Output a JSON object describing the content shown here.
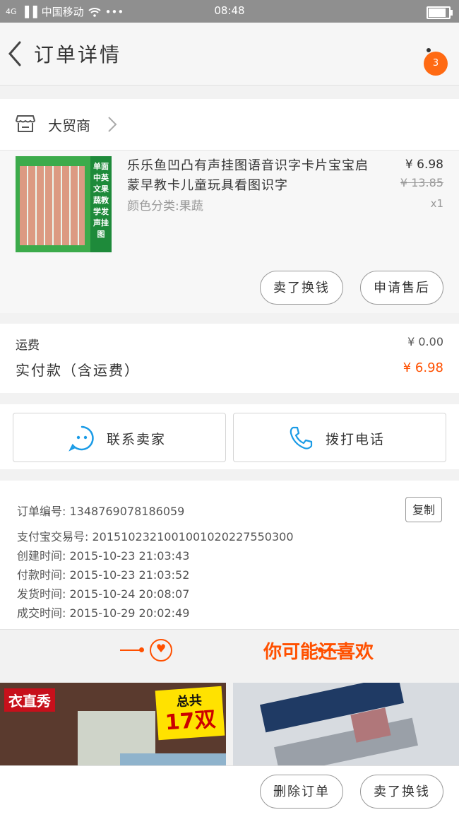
{
  "status_bar": {
    "signal": "4G",
    "carrier": "中国移动",
    "more": "•••",
    "time": "08:48",
    "battery_level": 0.85
  },
  "header": {
    "title": "订单详情",
    "notification_count": "3"
  },
  "shop": {
    "name": "大贸商"
  },
  "product": {
    "title": "乐乐鱼凹凸有声挂图语音识字卡片宝宝启蒙早教卡儿童玩具看图识字",
    "spec": "颜色分类:果蔬",
    "price": "¥ 6.98",
    "original_price": "¥ 13.85",
    "quantity": "x1",
    "thumb_text": "单面\n中英文果蔬教学发声挂图",
    "buttons": {
      "buy_again": "卖了换钱",
      "after_sale": "申请售后"
    }
  },
  "cost": {
    "shipping_label": "运费",
    "shipping_value": "¥ 0.00",
    "paid_label": "实付款（含运费）",
    "paid_value": "¥ 6.98"
  },
  "contact": {
    "seller": "联系卖家",
    "call": "拨打电话"
  },
  "order_info": {
    "order_no": "订单编号: 1348769078186059",
    "copy": "复制",
    "alipay_no": "支付宝交易号: 2015102321001001020227550300",
    "created": "创建时间: 2015-10-23 21:03:43",
    "paid": "付款时间: 2015-10-23 21:03:52",
    "shipped": "发货时间: 2015-10-24 20:08:07",
    "completed": "成交时间: 2015-10-29 20:02:49"
  },
  "recommend": {
    "title": "你可能还喜欢",
    "card1": {
      "brand": "衣直秀",
      "tag_line1": "总共",
      "tag_line2": "17双"
    }
  },
  "bottom_bar": {
    "delete_order": "删除订单",
    "sell": "卖了换钱"
  },
  "colors": {
    "accent": "#ff5000",
    "badge": "#ff6a13",
    "status_bar": "#8f8f8f"
  }
}
